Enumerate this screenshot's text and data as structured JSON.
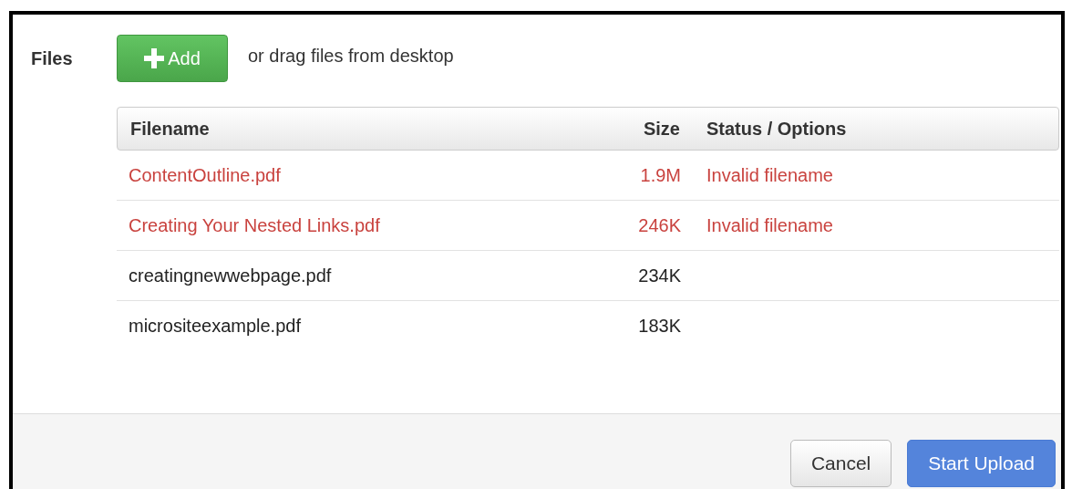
{
  "field_label": "Files",
  "add_button": {
    "label": "Add"
  },
  "drop_hint": "or drag files from desktop",
  "table": {
    "columns": [
      "Filename",
      "Size",
      "Status / Options"
    ],
    "rows": [
      {
        "filename": "ContentOutline.pdf",
        "size": "1.9M",
        "status": "Invalid filename",
        "error": true
      },
      {
        "filename": "Creating Your Nested Links.pdf",
        "size": "246K",
        "status": "Invalid filename",
        "error": true
      },
      {
        "filename": "creatingnewwebpage.pdf",
        "size": "234K",
        "error": false
      },
      {
        "filename": "micrositeexample.pdf",
        "size": "183K",
        "error": false
      }
    ]
  },
  "footer": {
    "buttons": [
      {
        "label": "Cancel",
        "kind": "default"
      },
      {
        "label": "Start Upload",
        "kind": "primary"
      }
    ]
  }
}
